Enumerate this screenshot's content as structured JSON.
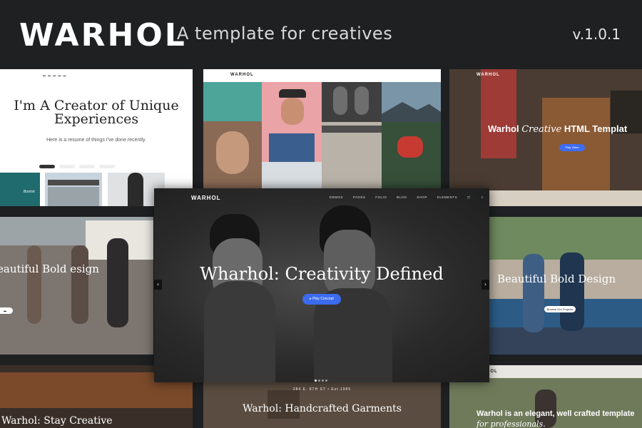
{
  "header": {
    "brand": "WARHOL",
    "tagline": "A template for creatives",
    "version": "v.1.0.1"
  },
  "tiles": {
    "resume": {
      "title": "I'm A Creator of Unique Experiences",
      "subtitle": "Here is a resume of things I've done recently.",
      "caption": "Bootst"
    },
    "grid": {
      "logo": "WARHOL"
    },
    "cafe": {
      "logo": "WARHOL",
      "title_a": "Warhol ",
      "title_b": "Creative",
      "title_c": " HTML Templat",
      "button": "Play Video"
    },
    "girls": {
      "title": "eautiful Bold esign"
    },
    "couple": {
      "title": "Beautiful Bold Design",
      "button": "Browse Our Projects"
    },
    "stay": {
      "title": "Warhol: Stay Creative"
    },
    "garments": {
      "address": "284 E. 8TH ST • Est.1985",
      "title": "Warhol: Handcrafted Garments"
    },
    "elegant": {
      "logo": "HOL",
      "title": "Warhol is an elegant, well crafted template",
      "subtitle": "for professionals."
    }
  },
  "main": {
    "logo": "WARHOL",
    "nav": [
      "DEMOS",
      "PAGES",
      "FOLIO",
      "BLOG",
      "SHOP",
      "ELEMENTS"
    ],
    "headline": "Wharhol: Creativity Defined",
    "cta": "Play Concept",
    "prev_icon": "chevron-left-icon",
    "next_icon": "chevron-right-icon"
  },
  "colors": {
    "background": "#1e2022",
    "accent": "#3b6cf0"
  }
}
